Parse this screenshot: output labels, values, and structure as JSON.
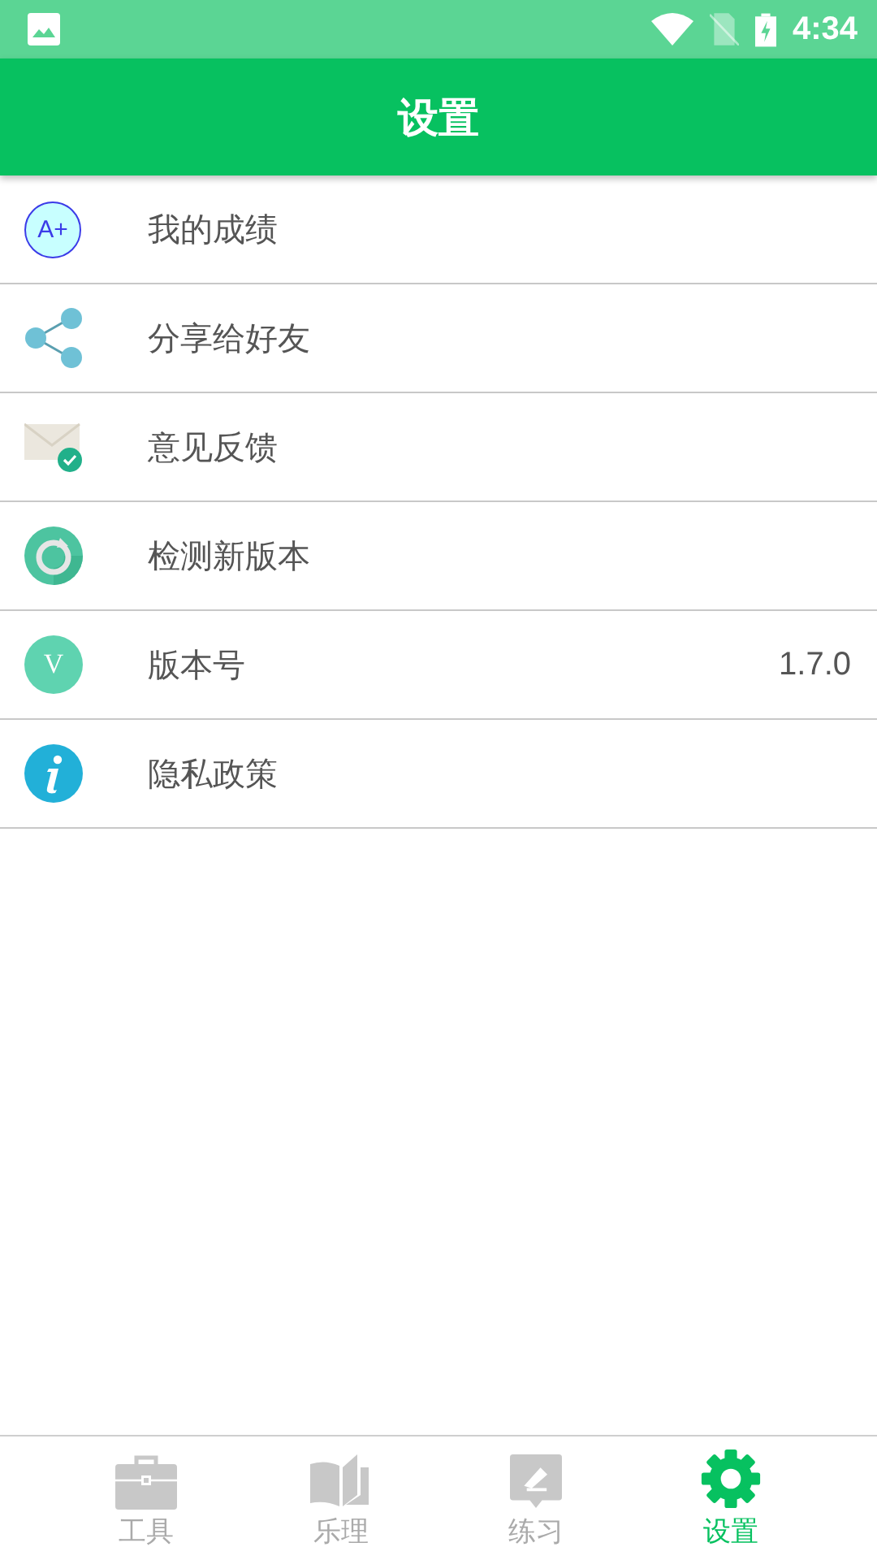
{
  "status_bar": {
    "time": "4:34"
  },
  "toolbar": {
    "title": "设置"
  },
  "settings": [
    {
      "kind": "grade",
      "badge": "A+",
      "label": "我的成绩"
    },
    {
      "kind": "share",
      "label": "分享给好友"
    },
    {
      "kind": "mail",
      "label": "意见反馈"
    },
    {
      "kind": "update",
      "label": "检测新版本"
    },
    {
      "kind": "version",
      "badge": "V",
      "label": "版本号",
      "value": "1.7.0"
    },
    {
      "kind": "info",
      "label": "隐私政策"
    }
  ],
  "bottom_nav": [
    {
      "kind": "toolbox",
      "label": "工具",
      "selected": false
    },
    {
      "kind": "book",
      "label": "乐理",
      "selected": false
    },
    {
      "kind": "practice",
      "label": "练习",
      "selected": false
    },
    {
      "kind": "gear",
      "label": "设置",
      "selected": true
    }
  ]
}
